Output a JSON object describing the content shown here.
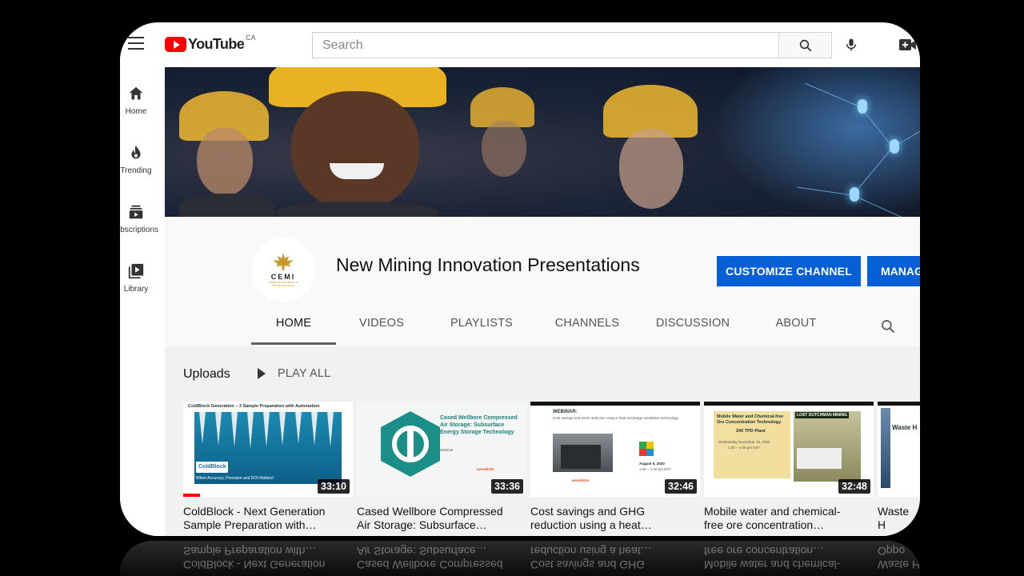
{
  "topbar": {
    "brand": "YouTube",
    "region": "CA",
    "search_placeholder": "Search"
  },
  "sidebar": {
    "items": [
      {
        "label": "Home",
        "icon": "home-icon"
      },
      {
        "label": "Trending",
        "icon": "flame-icon"
      },
      {
        "label": "Subscriptions",
        "icon": "subscriptions-icon"
      },
      {
        "label": "Library",
        "icon": "library-icon"
      }
    ]
  },
  "channel": {
    "name": "New Mining Innovation Presentations",
    "avatar_text": "CEMI",
    "avatar_subtext": "Centre for Excellence in Mining Innovation",
    "customize_label": "CUSTOMIZE CHANNEL",
    "manage_label": "MANAGE VIDEOS"
  },
  "tabs": [
    {
      "label": "HOME",
      "active": true
    },
    {
      "label": "VIDEOS",
      "active": false
    },
    {
      "label": "PLAYLISTS",
      "active": false
    },
    {
      "label": "CHANNELS",
      "active": false
    },
    {
      "label": "DISCUSSION",
      "active": false
    },
    {
      "label": "ABOUT",
      "active": false
    }
  ],
  "uploads": {
    "title": "Uploads",
    "play_all": "PLAY ALL",
    "videos": [
      {
        "title_line1": "ColdBlock - Next Generation",
        "title_line2": "Sample Preparation with…",
        "duration": "33:10",
        "watched_fraction": 0.1,
        "thumb_heading": "ColdBlock Generation – 3 Sample Preparation with Automation",
        "thumb_caption": "When Accuracy, Precision and ROI Matters!",
        "thumb_logo": "ColdBlock"
      },
      {
        "title_line1": "Cased Wellbore Compressed",
        "title_line2": "Air Storage: Subsurface…",
        "duration": "33:36",
        "thumb_heading": "Cased Wellbore Compressed Air Storage: Subsurface Energy Storage Technology",
        "thumb_caption": "Webinar",
        "thumb_logo": "eventbrite"
      },
      {
        "title_line1": "Cost savings and GHG",
        "title_line2": "reduction using a heat…",
        "duration": "32:46",
        "thumb_heading": "WEBINAR:",
        "thumb_caption": "Cost savings and GHG reduction using a heat exchange ventilation technology",
        "thumb_date": "August 5, 2020",
        "thumb_time": "1:00 – 1:30 pm EST",
        "thumb_logo": "eventbrite"
      },
      {
        "title_line1": "Mobile water and chemical-",
        "title_line2": "free ore concentration…",
        "duration": "32:48",
        "thumb_heading": "Mobile Water and Chemical-free Ore Concentration Technology",
        "thumb_caption": "240 TPD Plant",
        "thumb_date": "Wednesday November 18, 2020",
        "thumb_time": "1:30 – 2:00 pm EST",
        "thumb_logo": "LOST DUTCHMAN MINING"
      },
      {
        "title_line1": "Waste H",
        "title_line2": "Oppo",
        "duration": "",
        "thumb_heading": "Waste H"
      }
    ]
  }
}
